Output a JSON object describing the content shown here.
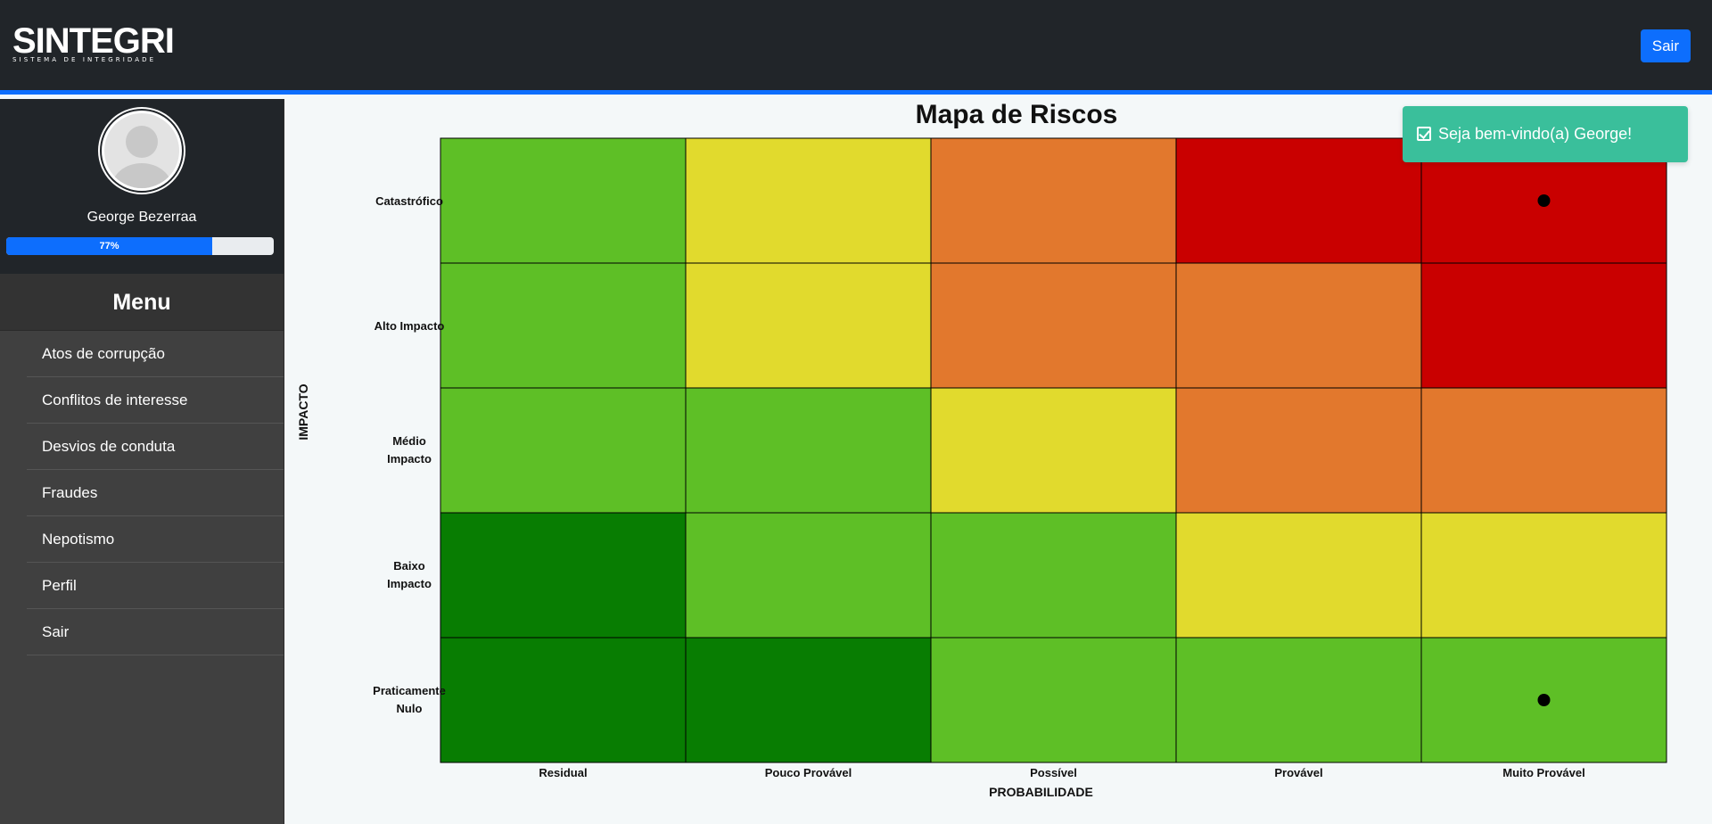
{
  "header": {
    "logo_text": "SINTEGRI",
    "logo_subtitle": "SISTEMA DE INTEGRIDADE",
    "logout_label": "Sair"
  },
  "sidebar": {
    "user_name": "George Bezerraa",
    "progress_percent": 77,
    "progress_label": "77%",
    "menu_title": "Menu",
    "items": [
      {
        "label": "Atos de corrupção"
      },
      {
        "label": "Conflitos de interesse"
      },
      {
        "label": "Desvios de conduta"
      },
      {
        "label": "Fraudes"
      },
      {
        "label": "Nepotismo"
      },
      {
        "label": "Perfil"
      },
      {
        "label": "Sair"
      }
    ]
  },
  "toast": {
    "message": "Seja bem-vindo(a) George!",
    "color": "#3abf9b"
  },
  "chart_data": {
    "type": "heatmap",
    "title": "Mapa de Riscos",
    "xlabel": "PROBABILIDADE",
    "ylabel": "IMPACTO",
    "x_categories": [
      "Residual",
      "Pouco Provável",
      "Possível",
      "Provável",
      "Muito Provável"
    ],
    "y_categories": [
      "Catastrófico",
      "Alto Impacto",
      "Médio Impacto",
      "Baixo Impacto",
      "Praticamente Nulo"
    ],
    "levels": {
      "dark_green": "#087d02",
      "green": "#5ebf26",
      "yellow": "#e1da2d",
      "orange": "#e2782d",
      "red": "#c90000"
    },
    "cells": [
      [
        "green",
        "yellow",
        "orange",
        "red",
        "red"
      ],
      [
        "green",
        "yellow",
        "orange",
        "orange",
        "red"
      ],
      [
        "green",
        "green",
        "yellow",
        "orange",
        "orange"
      ],
      [
        "dark_green",
        "green",
        "green",
        "yellow",
        "yellow"
      ],
      [
        "dark_green",
        "dark_green",
        "green",
        "green",
        "green"
      ]
    ],
    "points": [
      {
        "x": "Muito Provável",
        "y": "Catastrófico"
      },
      {
        "x": "Muito Provável",
        "y": "Praticamente Nulo"
      }
    ]
  }
}
